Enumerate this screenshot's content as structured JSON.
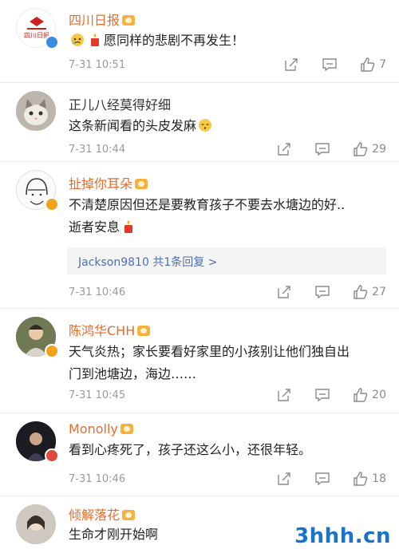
{
  "comments": [
    {
      "username": "四川日报",
      "text_before_emoji": "",
      "emoji_prefix": [
        "sad-face-emoji",
        "candle-emoji"
      ],
      "text": "愿同样的悲剧不再发生！",
      "time": "7-31 10:51",
      "likes": "7"
    },
    {
      "username": "正儿八经莫得好细",
      "text": "这条新闻看的头皮发麻",
      "time": "7-31 10:44",
      "likes": "29"
    },
    {
      "username": "扯掉你耳朵",
      "text_line1": "不清楚原因但还是要教育孩子不要去水塘边的好..",
      "text_line2": "逝者安息",
      "reply": "Jackson9810  共1条回复 >",
      "time": "7-31 10:46",
      "likes": "27"
    },
    {
      "username": "陈鸿华CHH",
      "text_line1": "天气炎热；家长要看好家里的小孩别让他们独自出",
      "text_line2": "门到池塘边，海边……",
      "time": "7-31 10:45",
      "likes": "20"
    },
    {
      "username": "Monolly",
      "text": "看到心疼死了，孩子还这么小，还很年轻。",
      "time": "7-31 10:46",
      "likes": "18"
    },
    {
      "username": "倾解落花",
      "text": "生命才刚开始啊"
    }
  ],
  "watermark": "3hhh.cn",
  "colors": {
    "username": "#e86b2a",
    "reply_link": "#4e6fb2",
    "meta": "#9a9a9a",
    "watermark": "#1a73c9"
  }
}
